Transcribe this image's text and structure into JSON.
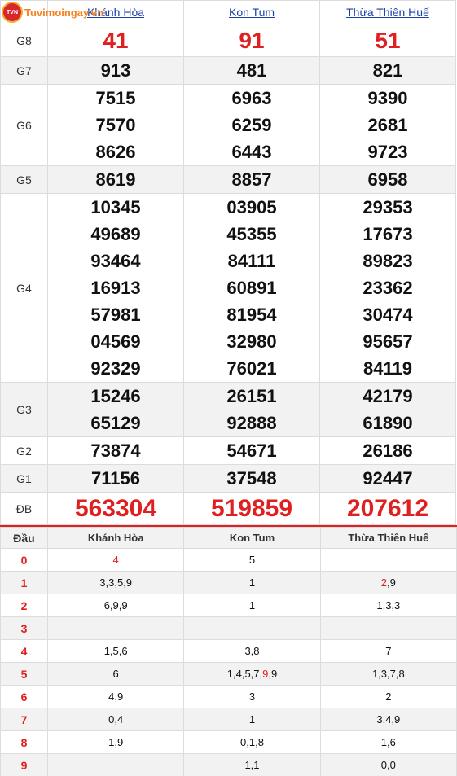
{
  "logo": {
    "text": "Tuvimoingay.vn",
    "emblem": "TVN"
  },
  "results": {
    "provinces": [
      "Khánh Hòa",
      "Kon Tum",
      "Thừa Thiên Huế"
    ],
    "rows": [
      {
        "label": "G8",
        "values": [
          [
            "41"
          ],
          [
            "91"
          ],
          [
            "51"
          ]
        ]
      },
      {
        "label": "G7",
        "values": [
          [
            "913"
          ],
          [
            "481"
          ],
          [
            "821"
          ]
        ]
      },
      {
        "label": "G6",
        "values": [
          [
            "7515",
            "7570",
            "8626"
          ],
          [
            "6963",
            "6259",
            "6443"
          ],
          [
            "9390",
            "2681",
            "9723"
          ]
        ]
      },
      {
        "label": "G5",
        "values": [
          [
            "8619"
          ],
          [
            "8857"
          ],
          [
            "6958"
          ]
        ]
      },
      {
        "label": "G4",
        "values": [
          [
            "10345",
            "49689",
            "93464",
            "16913",
            "57981",
            "04569",
            "92329"
          ],
          [
            "03905",
            "45355",
            "84111",
            "60891",
            "81954",
            "32980",
            "76021"
          ],
          [
            "29353",
            "17673",
            "89823",
            "23362",
            "30474",
            "95657",
            "84119"
          ]
        ]
      },
      {
        "label": "G3",
        "values": [
          [
            "15246",
            "65129"
          ],
          [
            "26151",
            "92888"
          ],
          [
            "42179",
            "61890"
          ]
        ]
      },
      {
        "label": "G2",
        "values": [
          [
            "73874"
          ],
          [
            "54671"
          ],
          [
            "26186"
          ]
        ]
      },
      {
        "label": "G1",
        "values": [
          [
            "71156"
          ],
          [
            "37548"
          ],
          [
            "92447"
          ]
        ]
      },
      {
        "label": "ĐB",
        "values": [
          [
            "563304"
          ],
          [
            "519859"
          ],
          [
            "207612"
          ]
        ]
      }
    ]
  },
  "loto": {
    "headers": [
      "Đầu",
      "Khánh Hòa",
      "Kon Tum",
      "Thừa Thiên Huế"
    ],
    "rows": [
      {
        "head": "0",
        "cells": [
          "4",
          "5",
          ""
        ]
      },
      {
        "head": "1",
        "cells": [
          "3,3,5,9",
          "1",
          "2,9"
        ]
      },
      {
        "head": "2",
        "cells": [
          "6,9,9",
          "1",
          "1,3,3"
        ]
      },
      {
        "head": "3",
        "cells": [
          "",
          "",
          ""
        ]
      },
      {
        "head": "4",
        "cells": [
          "1,5,6",
          "3,8",
          "7"
        ]
      },
      {
        "head": "5",
        "cells": [
          "6",
          "1,4,5,7,9,9",
          "1,3,7,8"
        ]
      },
      {
        "head": "6",
        "cells": [
          "4,9",
          "3",
          "2"
        ]
      },
      {
        "head": "7",
        "cells": [
          "0,4",
          "1",
          "3,4,9"
        ]
      },
      {
        "head": "8",
        "cells": [
          "1,9",
          "0,1,8",
          "1,6"
        ]
      },
      {
        "head": "9",
        "cells": [
          "",
          "1,1",
          "0,0"
        ]
      }
    ]
  },
  "colors": {
    "accent": "#e02020",
    "link": "#1a3fa8",
    "shade": "#f2f2f2",
    "logo": "#f58220"
  }
}
